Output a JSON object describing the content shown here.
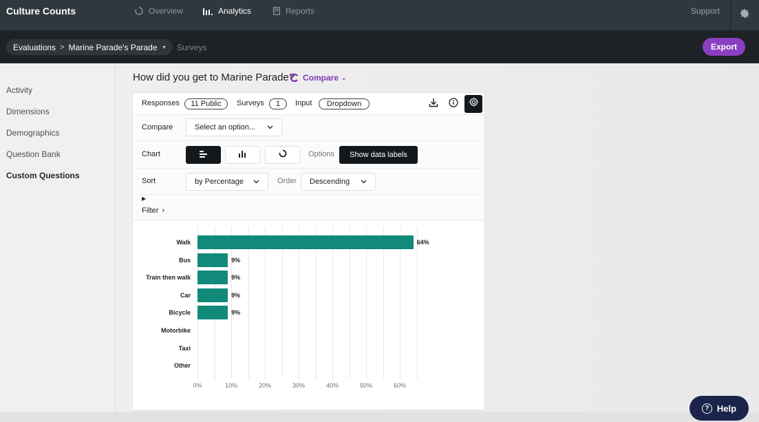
{
  "app": {
    "brand": "Culture Counts",
    "nav": [
      {
        "label": "Overview",
        "icon": "spinner-icon",
        "active": false
      },
      {
        "label": "Analytics",
        "icon": "bar-chart-icon",
        "active": true
      },
      {
        "label": "Reports",
        "icon": "document-icon",
        "active": false
      }
    ],
    "support_label": "Support",
    "settings_icon": "gear-icon"
  },
  "subbar": {
    "breadcrumb": {
      "root": "Evaluations",
      "separator": ">",
      "current": "Marine Parade's Parade",
      "caret": "▾"
    },
    "surveys_label": "Surveys",
    "export_label": "Export",
    "accent_color": "#8a3fc0"
  },
  "sidebar": {
    "items": [
      {
        "label": "Activity",
        "active": false
      },
      {
        "label": "Dimensions",
        "active": false
      },
      {
        "label": "Demographics",
        "active": false
      },
      {
        "label": "Question Bank",
        "active": false
      },
      {
        "label": "Custom Questions",
        "active": true
      }
    ]
  },
  "question": {
    "title": "How did you get to Marine Parade?",
    "compare_label": "Compare"
  },
  "card": {
    "responses_label": "Responses",
    "responses_value": "11 Public",
    "surveys_label": "Surveys",
    "surveys_value": "1",
    "input_label": "Input",
    "input_value": "Dropdown",
    "compare_label": "Compare",
    "compare_placeholder": "Select an option...",
    "chart_label": "Chart",
    "chart_types": [
      {
        "name": "horizontal-bar",
        "active": true
      },
      {
        "name": "vertical-bar",
        "active": false
      },
      {
        "name": "donut",
        "active": false
      }
    ],
    "options_label": "Options",
    "show_data_labels": "Show data labels",
    "sort_label": "Sort",
    "sort_value": "by Percentage",
    "order_label": "Order",
    "order_value": "Descending",
    "filter_toggle": "▶",
    "filter_label": "Filter",
    "filter_chevron": "›"
  },
  "chart_data": {
    "type": "bar",
    "orientation": "horizontal",
    "title": "",
    "xlabel": "",
    "ylabel": "",
    "categories": [
      "Walk",
      "Bus",
      "Train then walk",
      "Car",
      "Bicycle",
      "Motorbike",
      "Taxi",
      "Other"
    ],
    "values": [
      64,
      9,
      9,
      9,
      9,
      0,
      0,
      0
    ],
    "data_labels": [
      "64%",
      "9%",
      "9%",
      "9%",
      "9%",
      "",
      "",
      ""
    ],
    "xlim": [
      0,
      65
    ],
    "x_ticks": [
      "0%",
      "10%",
      "20%",
      "30%",
      "40%",
      "50%",
      "60%"
    ],
    "x_tick_values": [
      0,
      10,
      20,
      30,
      40,
      50,
      60
    ],
    "grid": true,
    "grid_step": 5,
    "bar_color": "#128a7a"
  },
  "help": {
    "label": "Help"
  }
}
